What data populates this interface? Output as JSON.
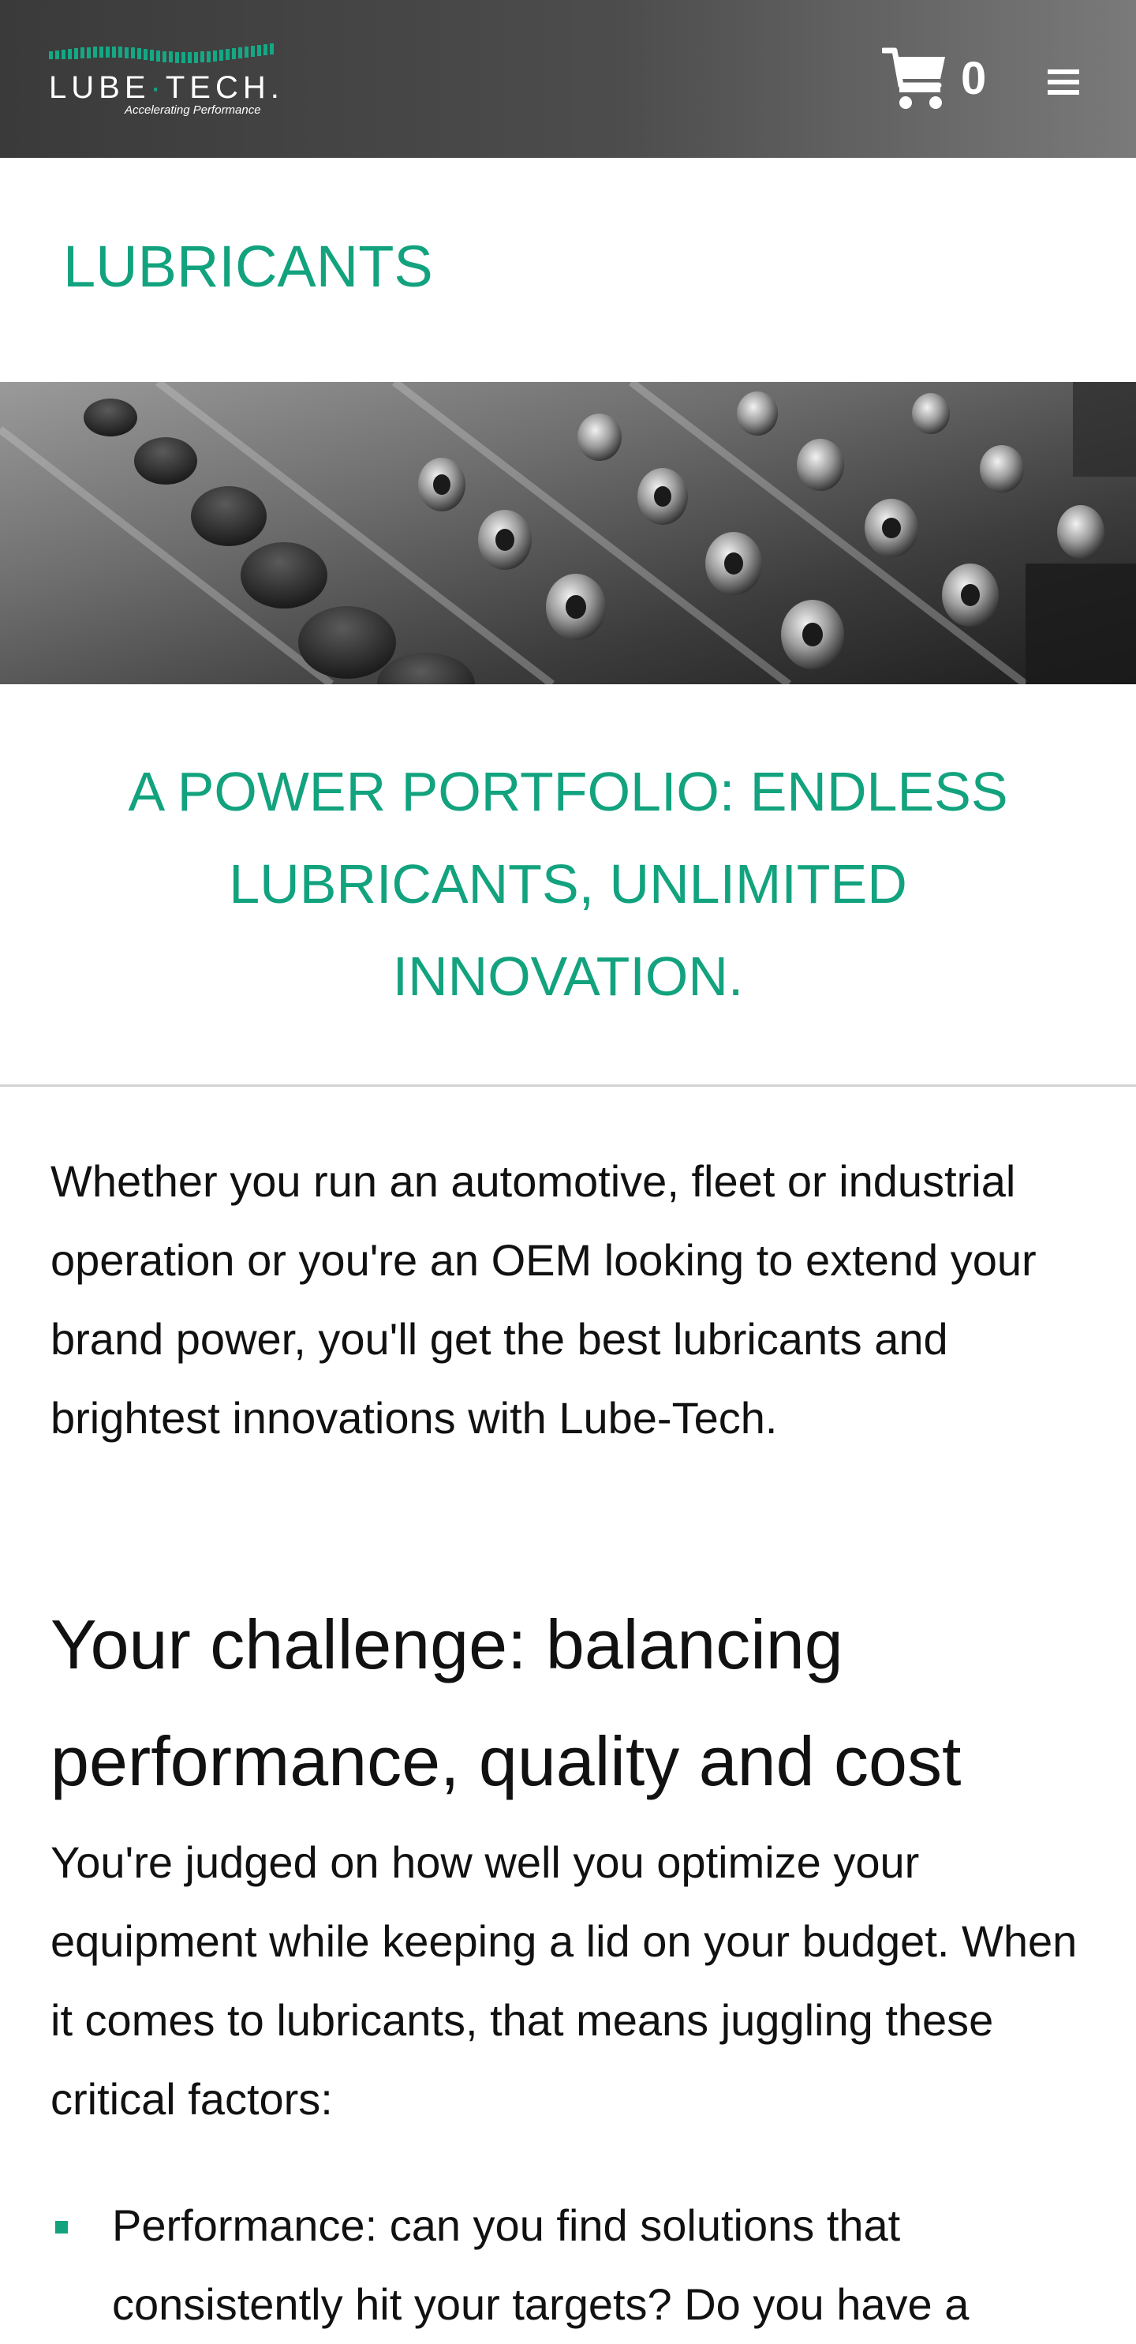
{
  "header": {
    "logo": {
      "wordmark_left": "LUBE",
      "wordmark_dot": "·",
      "wordmark_right": "TECH.",
      "tagline": "Accelerating Performance"
    },
    "cart": {
      "icon": "shopping-cart-icon",
      "count": "0"
    },
    "menu": {
      "icon": "hamburger-menu-icon"
    }
  },
  "page_title": "LUBRICANTS",
  "hero": {
    "description": "crankshafts"
  },
  "tagline_heading": "A POWER PORTFOLIO: ENDLESS LUBRICANTS, UNLIMITED INNOVATION.",
  "intro": "Whether you run an automotive, fleet or industrial operation or you're an OEM looking to extend your brand power, you'll get the best lubricants and brightest innovations with Lube-Tech.",
  "section": {
    "heading": "Your challenge: balancing performance, quality and cost",
    "body": "You're judged on how well you optimize your equipment while keeping a lid on your budget. When it comes to lubricants, that means juggling these critical factors:",
    "bullets": [
      "Performance: can you find solutions that consistently hit your targets? Do you have a"
    ]
  },
  "colors": {
    "accent": "#12a37e",
    "header_dark": "#3a3a3a",
    "header_light": "#7a7a7a",
    "text": "#111111",
    "divider": "#d2d2d2"
  }
}
